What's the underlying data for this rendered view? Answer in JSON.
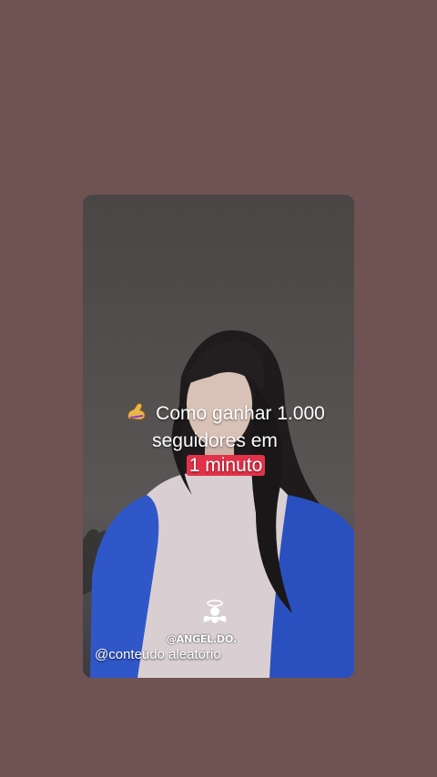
{
  "background_color": "#6f5352",
  "story": {
    "caption": {
      "emoji_icon": "muscle-icon",
      "line1": "Como ganhar 1.000",
      "line2": "seguidores em",
      "line3": "1 minuto",
      "highlight_color": "#e2324a"
    },
    "watermark": "@ANGEL.DO.",
    "watermark_icon": "angel-icon"
  },
  "handle": "@conteúdo aleatório"
}
